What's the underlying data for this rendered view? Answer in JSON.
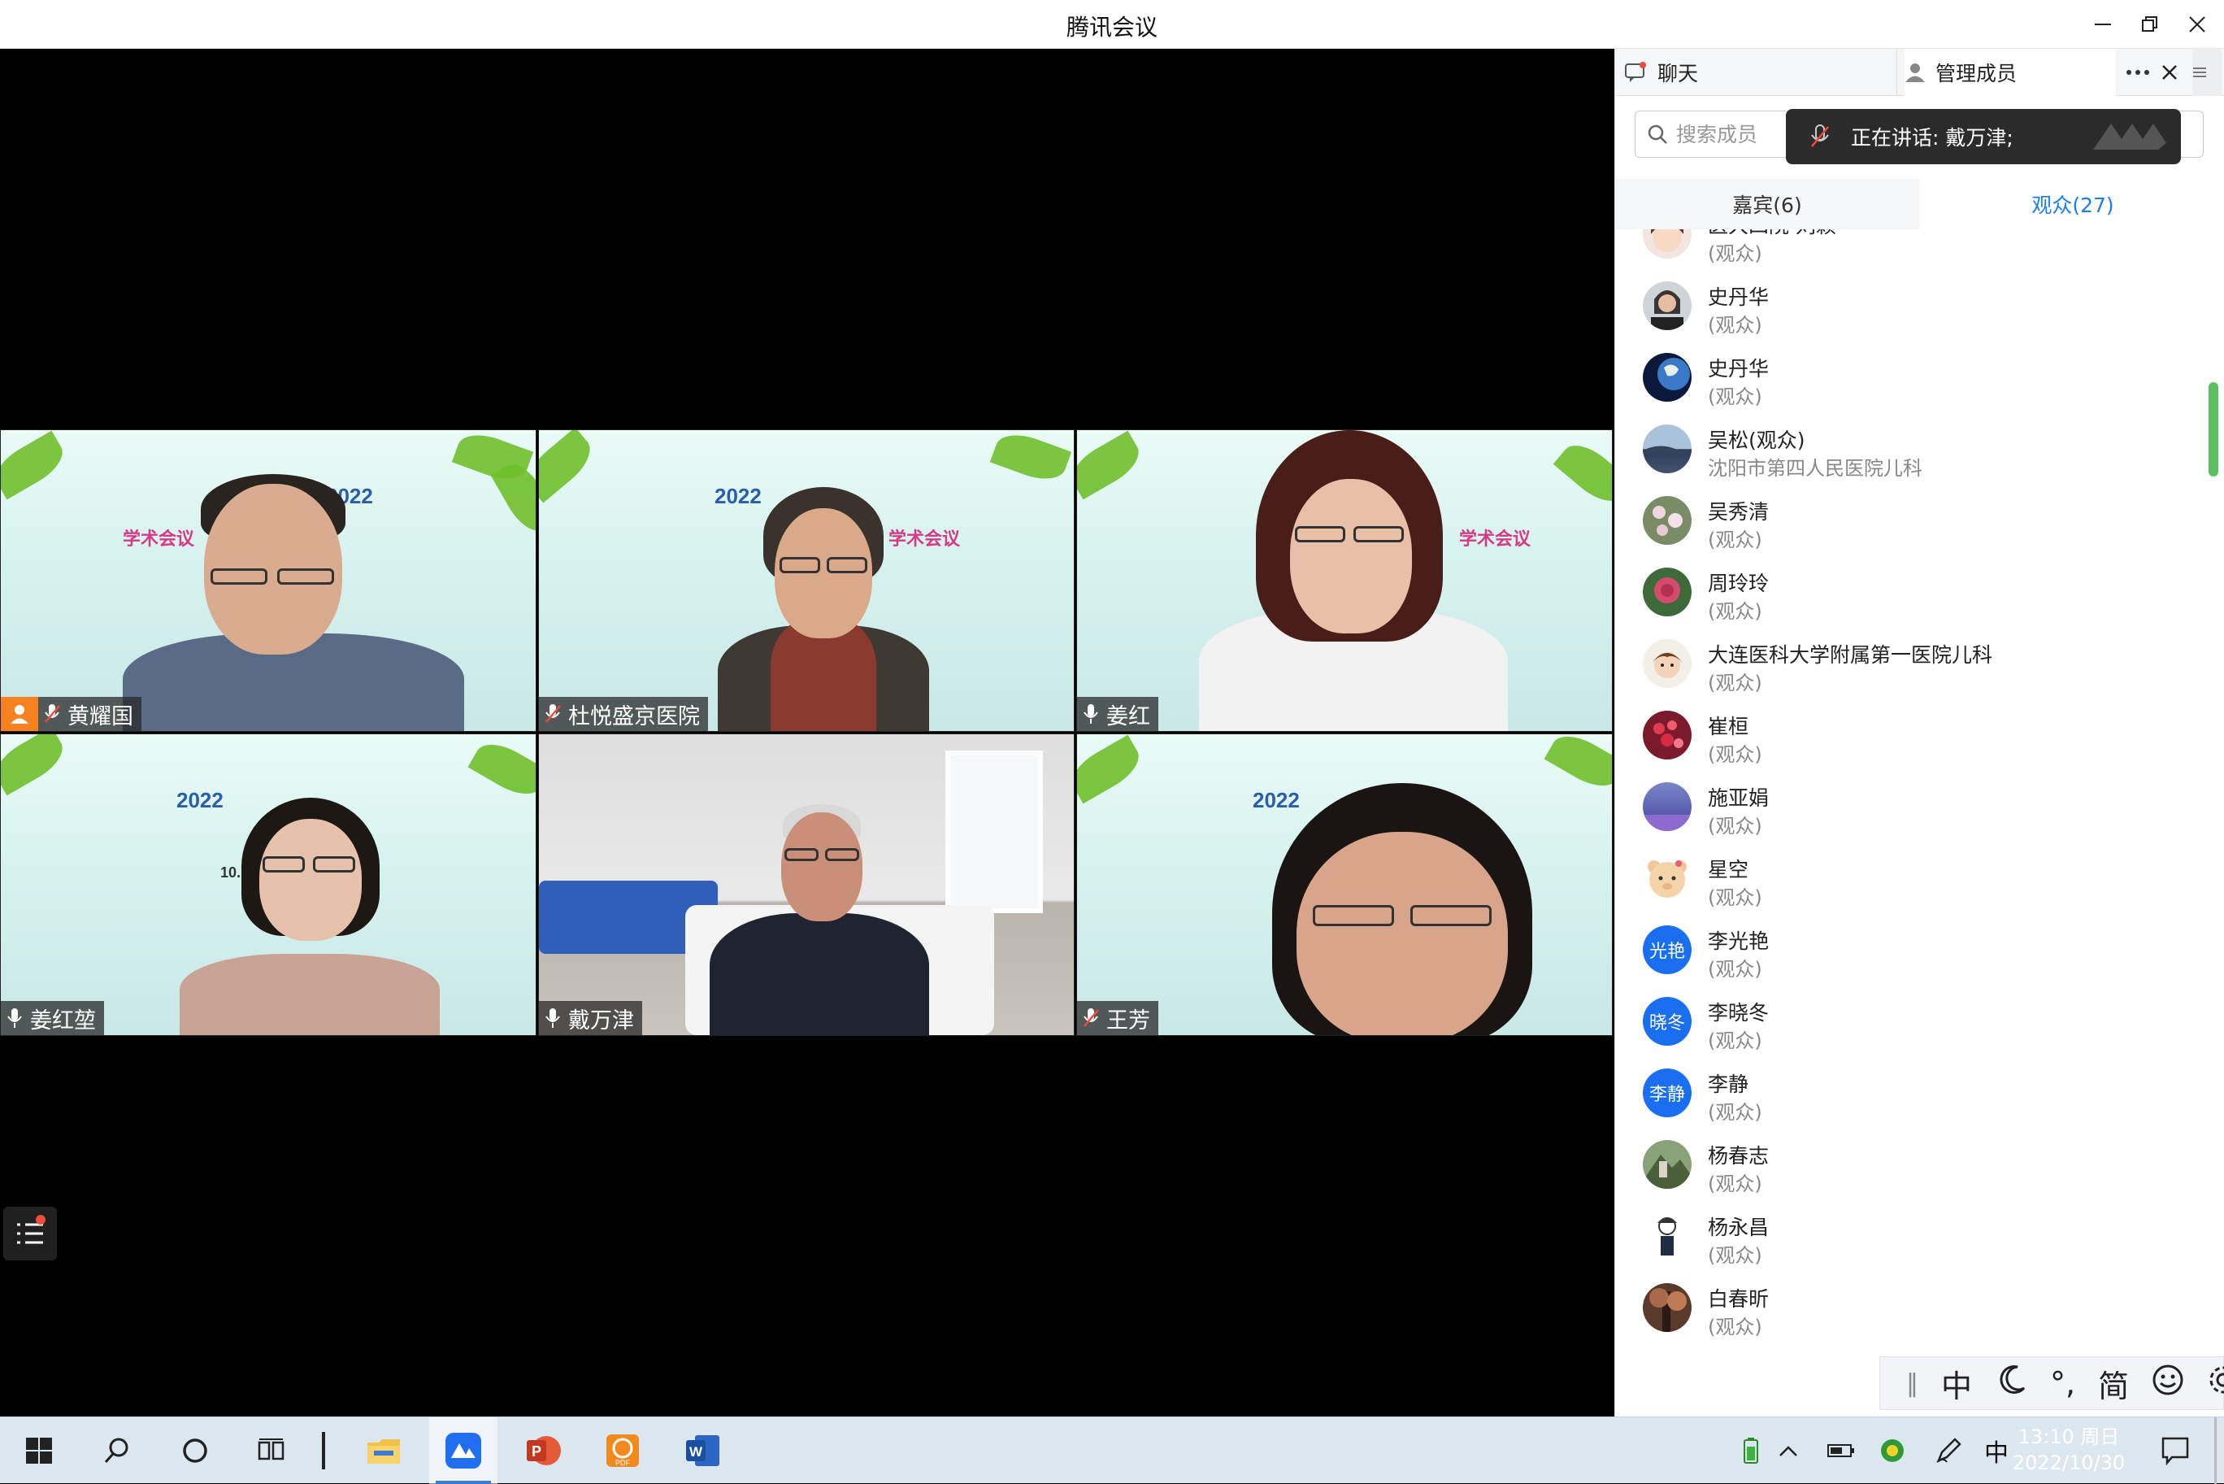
{
  "window": {
    "title": "腾讯会议"
  },
  "video_tiles": [
    {
      "name": "黄耀国",
      "mic": "muted",
      "host": true
    },
    {
      "name": "杜悦盛京医院",
      "mic": "muted",
      "host": false
    },
    {
      "name": "姜红",
      "mic": "on",
      "host": false
    },
    {
      "name": "姜红堃",
      "mic": "on",
      "host": false
    },
    {
      "name": "戴万津",
      "mic": "on",
      "host": false
    },
    {
      "name": "王芳",
      "mic": "muted",
      "host": false
    }
  ],
  "banner": {
    "year": "2022",
    "meeting_text": "学术会议",
    "date": "10. 30"
  },
  "panel": {
    "tab_chat": "聊天",
    "tab_members": "管理成员",
    "search_placeholder": "搜索成员",
    "speaking_text": "正在讲话: 戴万津;",
    "tab_guests": "嘉宾(6)",
    "tab_audience": "观众(27)",
    "members": [
      {
        "name": "医大四院 刘颖",
        "role": "(观众)",
        "avatar": "cartoon-girl"
      },
      {
        "name": "史丹华",
        "role": "(观众)",
        "avatar": "photo-woman"
      },
      {
        "name": "史丹华",
        "role": "(观众)",
        "avatar": "earth"
      },
      {
        "name": "吴松(观众)",
        "role": "沈阳市第四人民医院儿科",
        "avatar": "lake"
      },
      {
        "name": "吴秀清",
        "role": "(观众)",
        "avatar": "flowers"
      },
      {
        "name": "周玲玲",
        "role": "(观众)",
        "avatar": "rose"
      },
      {
        "name": "大连医科大学附属第一医院儿科",
        "role": "(观众)",
        "avatar": "cartoon-boy"
      },
      {
        "name": "崔桓",
        "role": "(观众)",
        "avatar": "berries"
      },
      {
        "name": "施亚娟",
        "role": "(观众)",
        "avatar": "lavender"
      },
      {
        "name": "星空",
        "role": "(观众)",
        "avatar": "bear"
      },
      {
        "name": "李光艳",
        "role": "(观众)",
        "avatar": "text",
        "avatar_text": "光艳"
      },
      {
        "name": "李晓冬",
        "role": "(观众)",
        "avatar": "text",
        "avatar_text": "晓冬"
      },
      {
        "name": "李静",
        "role": "(观众)",
        "avatar": "text",
        "avatar_text": "李静"
      },
      {
        "name": "杨春志",
        "role": "(观众)",
        "avatar": "mountain"
      },
      {
        "name": "杨永昌",
        "role": "(观众)",
        "avatar": "sketch"
      },
      {
        "name": "白春昕",
        "role": "(观众)",
        "avatar": "tree"
      }
    ]
  },
  "ime": {
    "mode": "中",
    "punct": "°,",
    "charset": "简"
  },
  "taskbar": {
    "ime_indicator": "中",
    "time": "13:10 周日",
    "date": "2022/10/30"
  },
  "colors": {
    "accent": "#1a7cf0",
    "host_badge": "#f5821f",
    "text_avatar": "#1a6ff0"
  }
}
